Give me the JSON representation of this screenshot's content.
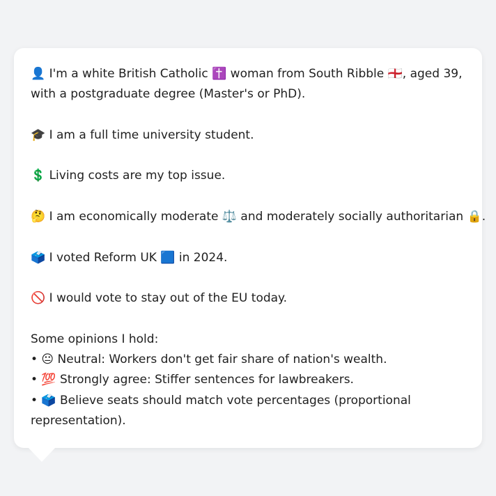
{
  "profile": {
    "identity": "👤 I'm a white British Catholic ✝️ woman from South Ribble 🏴󠁧󠁢󠁥󠁮󠁧󠁿, aged 39, with a postgraduate degree (Master's or PhD).",
    "occupation": "🎓 I am a full time university student.",
    "top_issue": "💲 Living costs are my top issue.",
    "ideology": "🤔 I am economically moderate ⚖️ and moderately socially authoritarian 🔒.",
    "vote_2024": "🗳️ I voted Reform UK 🟦 in 2024.",
    "eu": "🚫 I would vote to stay out of the EU today."
  },
  "opinions": {
    "heading": "Some opinions I hold:",
    "items": [
      "• 😐 Neutral: Workers don't get fair share of nation's wealth.",
      "• 💯 Strongly agree: Stiffer sentences for lawbreakers.",
      "• 🗳️ Believe seats should match vote percentages (proportional representation)."
    ]
  }
}
